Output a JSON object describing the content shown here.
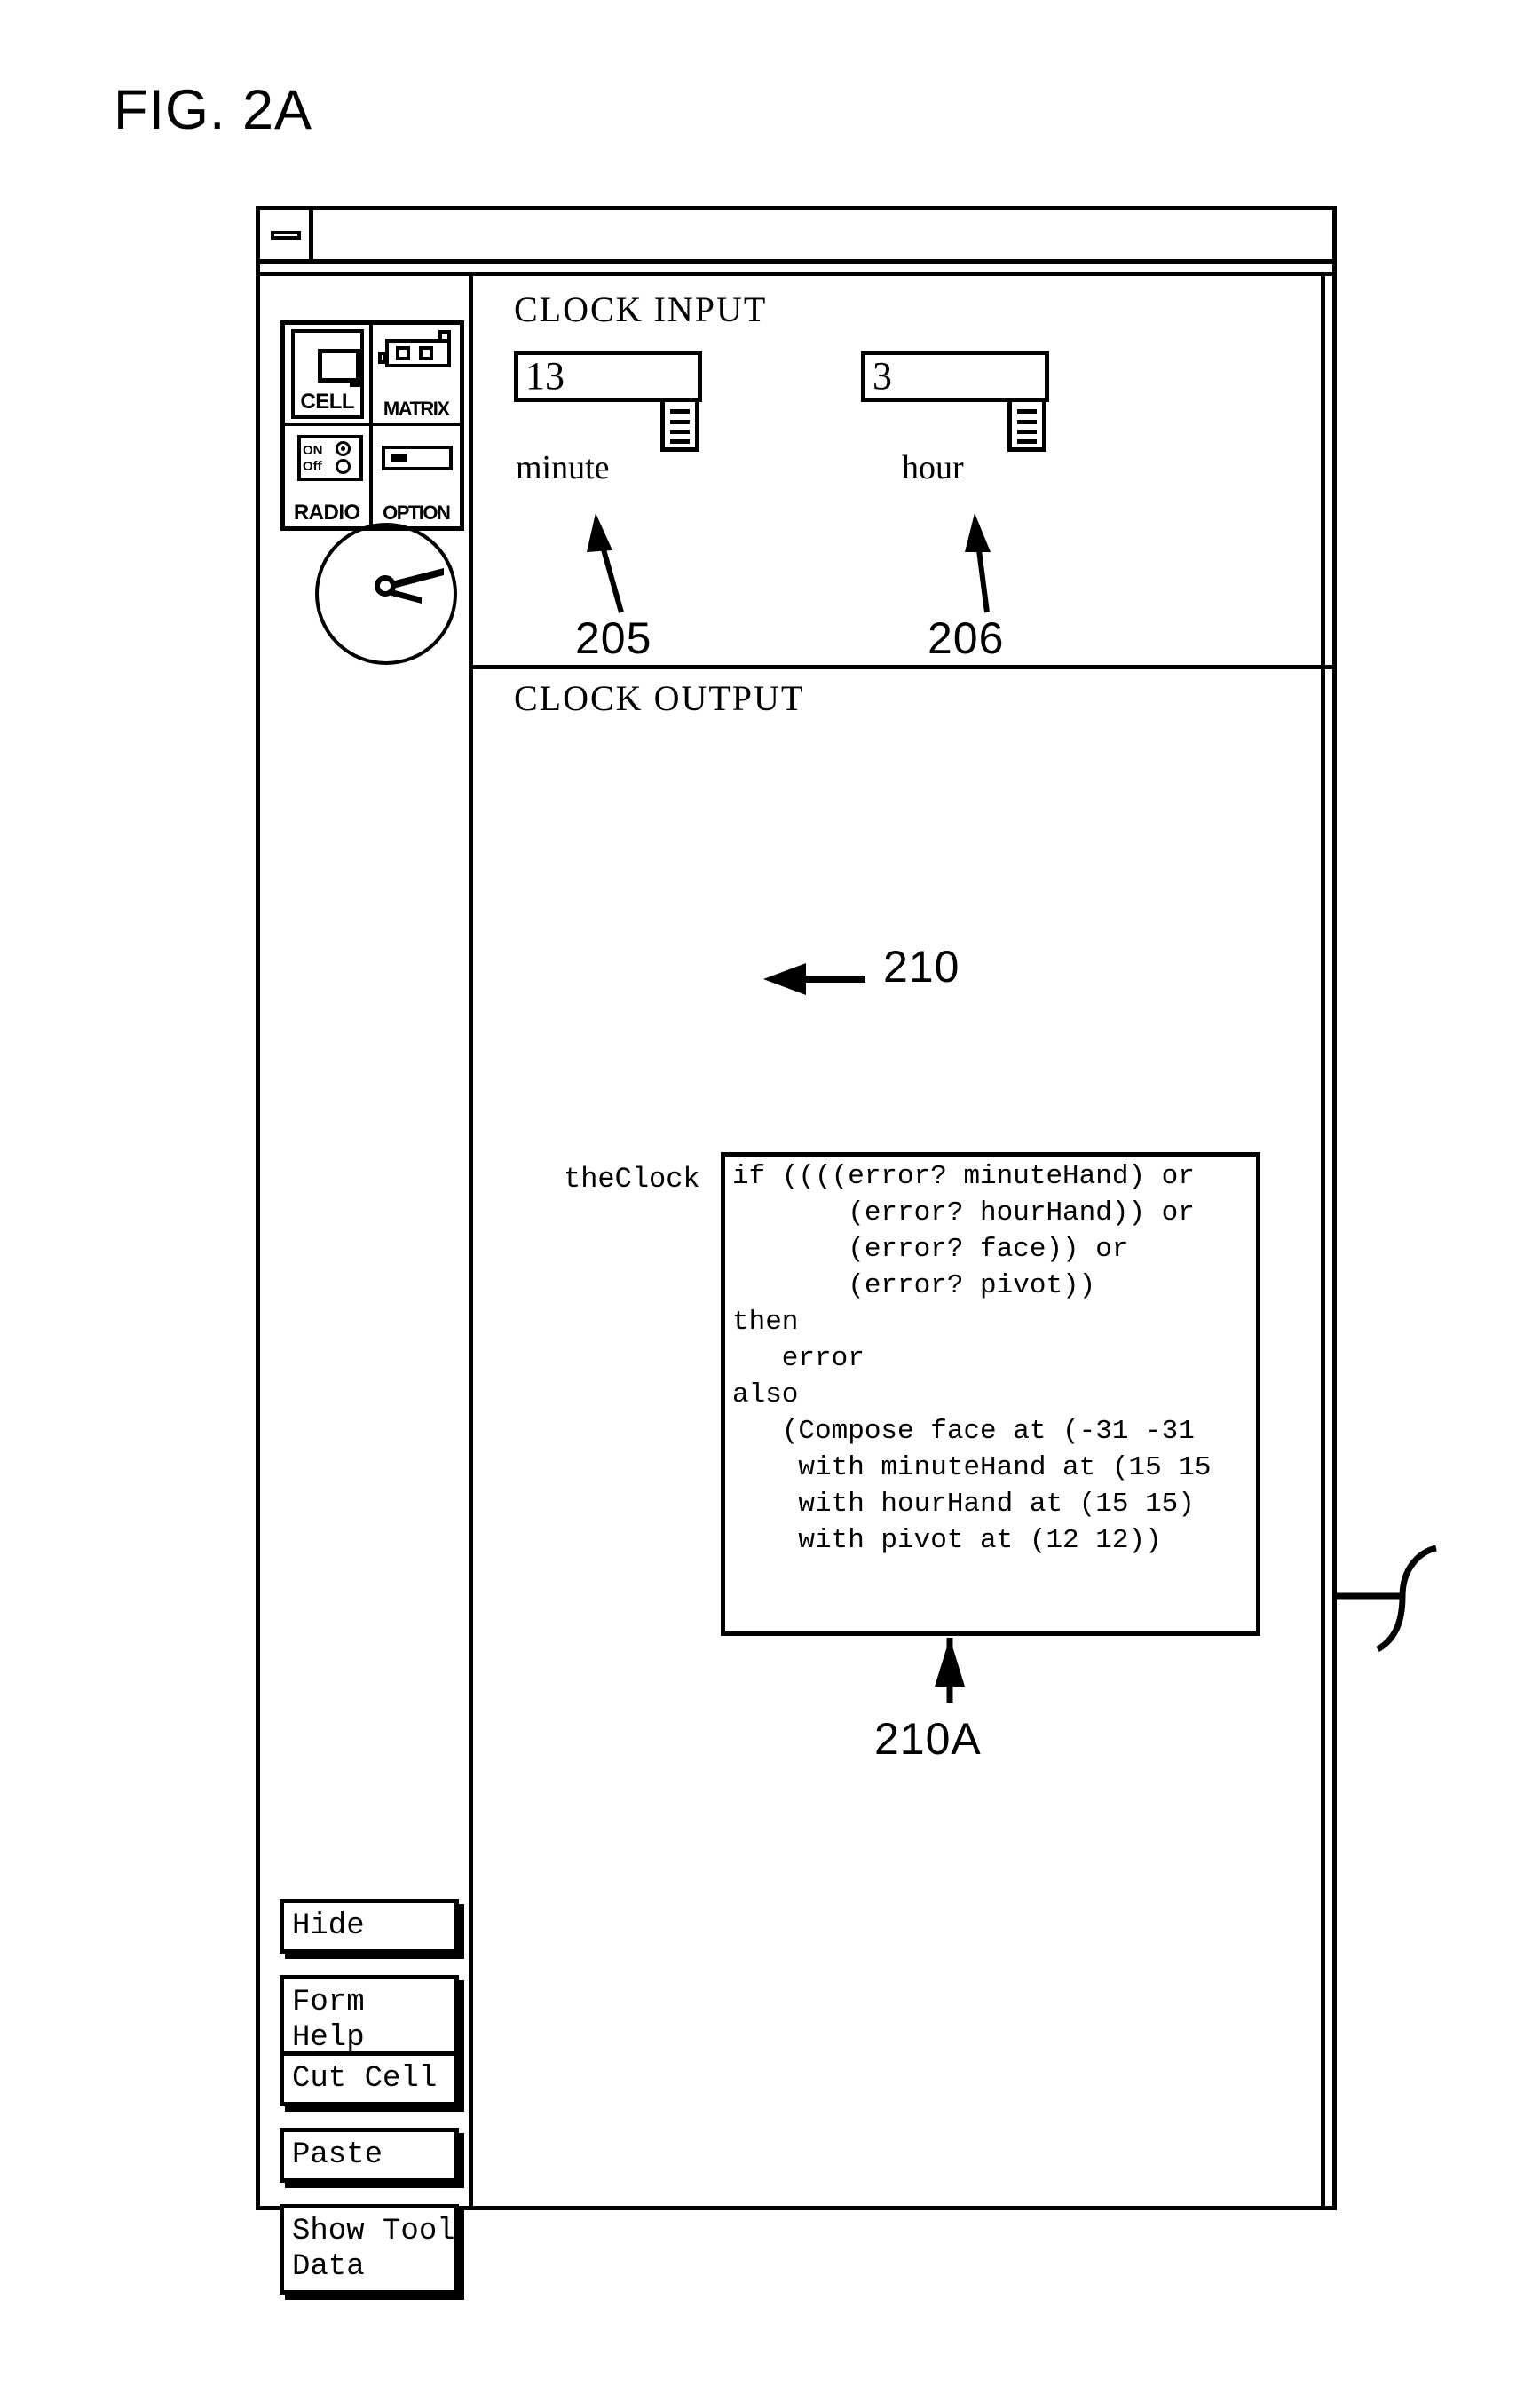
{
  "figure": {
    "label": "FIG. 2A"
  },
  "window": {
    "minimize_icon": "minimize-icon"
  },
  "palette": {
    "items": [
      {
        "caption": "CELL",
        "icon": "cell-icon"
      },
      {
        "caption": "MATRIX",
        "icon": "matrix-icon"
      },
      {
        "caption": "RADIO",
        "icon": "radio-icon",
        "on_label": "ON",
        "off_label": "Off"
      },
      {
        "caption": "OPTION",
        "icon": "option-icon"
      }
    ]
  },
  "sections": {
    "input": {
      "title": "CLOCK INPUT",
      "fields": [
        {
          "label": "minute",
          "value": "13",
          "callout": "205"
        },
        {
          "label": "hour",
          "value": "3",
          "callout": "206"
        }
      ]
    },
    "output": {
      "title": "CLOCK OUTPUT",
      "clock_callout": "210",
      "code_label": "theClock",
      "code_callout": "210A",
      "code_text": "if ((((error? minuteHand) or\n       (error? hourHand)) or\n       (error? face)) or\n       (error? pivot))\nthen\n   error\nalso\n   (Compose face at (-31 -31\n    with minuteHand at (15 15\n    with hourHand at (15 15)\n    with pivot at (12 12))"
    }
  },
  "buttons": [
    {
      "label": "Hide"
    },
    {
      "label": "Form Help"
    },
    {
      "label": "Cut Cell"
    },
    {
      "label": "Paste"
    },
    {
      "label": "Show Tool\nData"
    }
  ]
}
